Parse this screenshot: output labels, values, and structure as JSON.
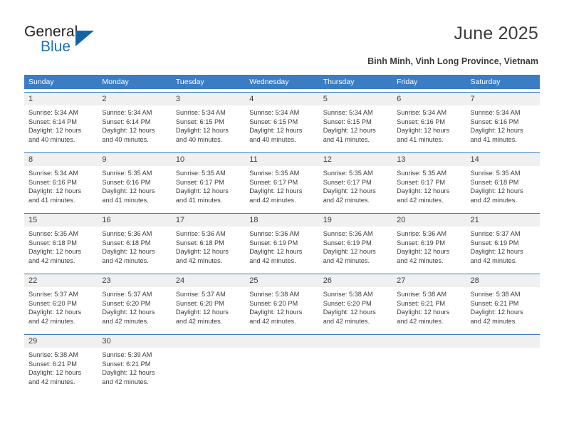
{
  "brand": {
    "name_top": "General",
    "name_bottom": "Blue",
    "triangle_icon": "triangle-icon",
    "color_dark": "#231f20",
    "color_blue": "#1b72b8"
  },
  "header": {
    "title": "June 2025",
    "subtitle": "Binh Minh, Vinh Long Province, Vietnam"
  },
  "theme": {
    "header_blue": "#3b7dc4",
    "daynum_gray": "#f0f0f0",
    "text_color": "#3c3c3c"
  },
  "calendar": {
    "weekdays": [
      "Sunday",
      "Monday",
      "Tuesday",
      "Wednesday",
      "Thursday",
      "Friday",
      "Saturday"
    ],
    "weeks": [
      [
        {
          "day": "1",
          "sunrise": "Sunrise: 5:34 AM",
          "sunset": "Sunset: 6:14 PM",
          "daylight1": "Daylight: 12 hours",
          "daylight2": "and 40 minutes."
        },
        {
          "day": "2",
          "sunrise": "Sunrise: 5:34 AM",
          "sunset": "Sunset: 6:14 PM",
          "daylight1": "Daylight: 12 hours",
          "daylight2": "and 40 minutes."
        },
        {
          "day": "3",
          "sunrise": "Sunrise: 5:34 AM",
          "sunset": "Sunset: 6:15 PM",
          "daylight1": "Daylight: 12 hours",
          "daylight2": "and 40 minutes."
        },
        {
          "day": "4",
          "sunrise": "Sunrise: 5:34 AM",
          "sunset": "Sunset: 6:15 PM",
          "daylight1": "Daylight: 12 hours",
          "daylight2": "and 40 minutes."
        },
        {
          "day": "5",
          "sunrise": "Sunrise: 5:34 AM",
          "sunset": "Sunset: 6:15 PM",
          "daylight1": "Daylight: 12 hours",
          "daylight2": "and 41 minutes."
        },
        {
          "day": "6",
          "sunrise": "Sunrise: 5:34 AM",
          "sunset": "Sunset: 6:16 PM",
          "daylight1": "Daylight: 12 hours",
          "daylight2": "and 41 minutes."
        },
        {
          "day": "7",
          "sunrise": "Sunrise: 5:34 AM",
          "sunset": "Sunset: 6:16 PM",
          "daylight1": "Daylight: 12 hours",
          "daylight2": "and 41 minutes."
        }
      ],
      [
        {
          "day": "8",
          "sunrise": "Sunrise: 5:34 AM",
          "sunset": "Sunset: 6:16 PM",
          "daylight1": "Daylight: 12 hours",
          "daylight2": "and 41 minutes."
        },
        {
          "day": "9",
          "sunrise": "Sunrise: 5:35 AM",
          "sunset": "Sunset: 6:16 PM",
          "daylight1": "Daylight: 12 hours",
          "daylight2": "and 41 minutes."
        },
        {
          "day": "10",
          "sunrise": "Sunrise: 5:35 AM",
          "sunset": "Sunset: 6:17 PM",
          "daylight1": "Daylight: 12 hours",
          "daylight2": "and 41 minutes."
        },
        {
          "day": "11",
          "sunrise": "Sunrise: 5:35 AM",
          "sunset": "Sunset: 6:17 PM",
          "daylight1": "Daylight: 12 hours",
          "daylight2": "and 42 minutes."
        },
        {
          "day": "12",
          "sunrise": "Sunrise: 5:35 AM",
          "sunset": "Sunset: 6:17 PM",
          "daylight1": "Daylight: 12 hours",
          "daylight2": "and 42 minutes."
        },
        {
          "day": "13",
          "sunrise": "Sunrise: 5:35 AM",
          "sunset": "Sunset: 6:17 PM",
          "daylight1": "Daylight: 12 hours",
          "daylight2": "and 42 minutes."
        },
        {
          "day": "14",
          "sunrise": "Sunrise: 5:35 AM",
          "sunset": "Sunset: 6:18 PM",
          "daylight1": "Daylight: 12 hours",
          "daylight2": "and 42 minutes."
        }
      ],
      [
        {
          "day": "15",
          "sunrise": "Sunrise: 5:35 AM",
          "sunset": "Sunset: 6:18 PM",
          "daylight1": "Daylight: 12 hours",
          "daylight2": "and 42 minutes."
        },
        {
          "day": "16",
          "sunrise": "Sunrise: 5:36 AM",
          "sunset": "Sunset: 6:18 PM",
          "daylight1": "Daylight: 12 hours",
          "daylight2": "and 42 minutes."
        },
        {
          "day": "17",
          "sunrise": "Sunrise: 5:36 AM",
          "sunset": "Sunset: 6:18 PM",
          "daylight1": "Daylight: 12 hours",
          "daylight2": "and 42 minutes."
        },
        {
          "day": "18",
          "sunrise": "Sunrise: 5:36 AM",
          "sunset": "Sunset: 6:19 PM",
          "daylight1": "Daylight: 12 hours",
          "daylight2": "and 42 minutes."
        },
        {
          "day": "19",
          "sunrise": "Sunrise: 5:36 AM",
          "sunset": "Sunset: 6:19 PM",
          "daylight1": "Daylight: 12 hours",
          "daylight2": "and 42 minutes."
        },
        {
          "day": "20",
          "sunrise": "Sunrise: 5:36 AM",
          "sunset": "Sunset: 6:19 PM",
          "daylight1": "Daylight: 12 hours",
          "daylight2": "and 42 minutes."
        },
        {
          "day": "21",
          "sunrise": "Sunrise: 5:37 AM",
          "sunset": "Sunset: 6:19 PM",
          "daylight1": "Daylight: 12 hours",
          "daylight2": "and 42 minutes."
        }
      ],
      [
        {
          "day": "22",
          "sunrise": "Sunrise: 5:37 AM",
          "sunset": "Sunset: 6:20 PM",
          "daylight1": "Daylight: 12 hours",
          "daylight2": "and 42 minutes."
        },
        {
          "day": "23",
          "sunrise": "Sunrise: 5:37 AM",
          "sunset": "Sunset: 6:20 PM",
          "daylight1": "Daylight: 12 hours",
          "daylight2": "and 42 minutes."
        },
        {
          "day": "24",
          "sunrise": "Sunrise: 5:37 AM",
          "sunset": "Sunset: 6:20 PM",
          "daylight1": "Daylight: 12 hours",
          "daylight2": "and 42 minutes."
        },
        {
          "day": "25",
          "sunrise": "Sunrise: 5:38 AM",
          "sunset": "Sunset: 6:20 PM",
          "daylight1": "Daylight: 12 hours",
          "daylight2": "and 42 minutes."
        },
        {
          "day": "26",
          "sunrise": "Sunrise: 5:38 AM",
          "sunset": "Sunset: 6:20 PM",
          "daylight1": "Daylight: 12 hours",
          "daylight2": "and 42 minutes."
        },
        {
          "day": "27",
          "sunrise": "Sunrise: 5:38 AM",
          "sunset": "Sunset: 6:21 PM",
          "daylight1": "Daylight: 12 hours",
          "daylight2": "and 42 minutes."
        },
        {
          "day": "28",
          "sunrise": "Sunrise: 5:38 AM",
          "sunset": "Sunset: 6:21 PM",
          "daylight1": "Daylight: 12 hours",
          "daylight2": "and 42 minutes."
        }
      ],
      [
        {
          "day": "29",
          "sunrise": "Sunrise: 5:38 AM",
          "sunset": "Sunset: 6:21 PM",
          "daylight1": "Daylight: 12 hours",
          "daylight2": "and 42 minutes."
        },
        {
          "day": "30",
          "sunrise": "Sunrise: 5:39 AM",
          "sunset": "Sunset: 6:21 PM",
          "daylight1": "Daylight: 12 hours",
          "daylight2": "and 42 minutes."
        },
        {
          "day": "",
          "sunrise": "",
          "sunset": "",
          "daylight1": "",
          "daylight2": ""
        },
        {
          "day": "",
          "sunrise": "",
          "sunset": "",
          "daylight1": "",
          "daylight2": ""
        },
        {
          "day": "",
          "sunrise": "",
          "sunset": "",
          "daylight1": "",
          "daylight2": ""
        },
        {
          "day": "",
          "sunrise": "",
          "sunset": "",
          "daylight1": "",
          "daylight2": ""
        },
        {
          "day": "",
          "sunrise": "",
          "sunset": "",
          "daylight1": "",
          "daylight2": ""
        }
      ]
    ]
  }
}
